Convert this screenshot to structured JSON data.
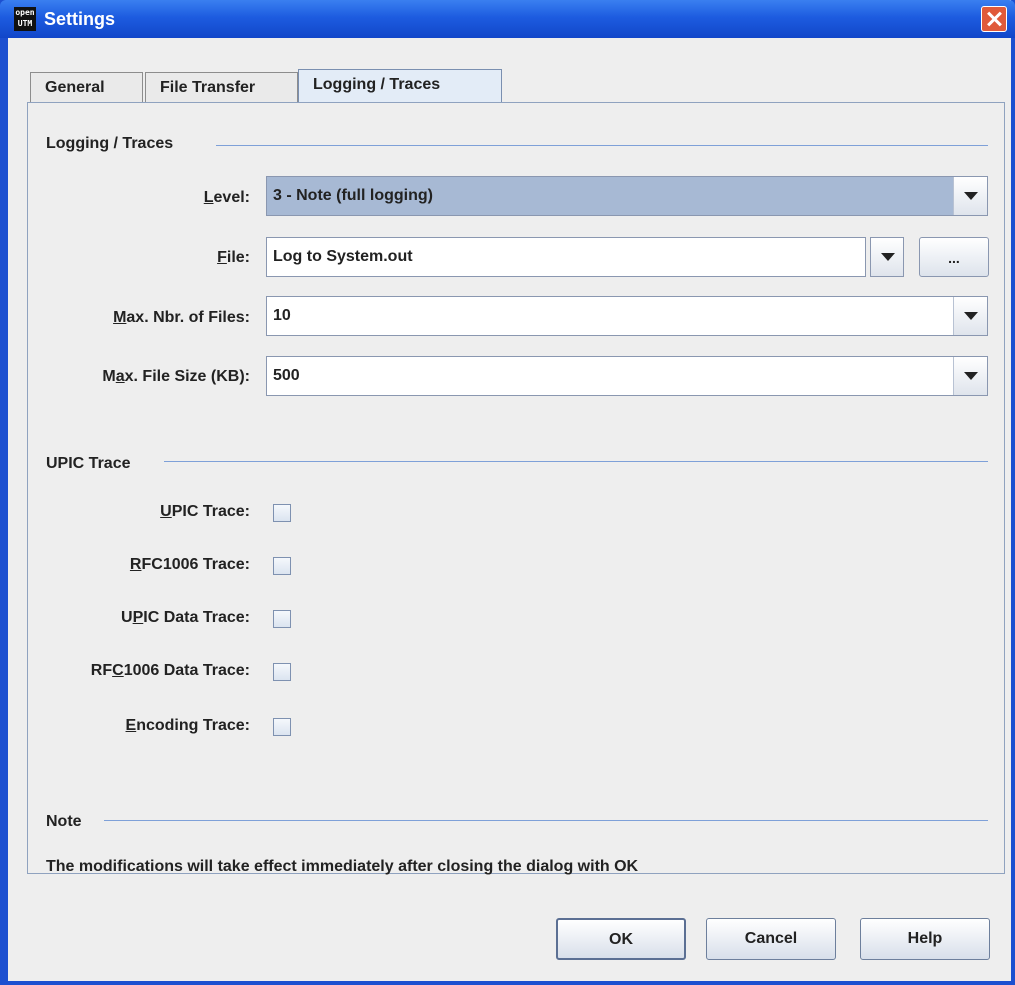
{
  "window": {
    "title": "Settings",
    "icon_text_top": "open",
    "icon_text_bottom": "UTM"
  },
  "tabs": [
    {
      "label": "General",
      "active": false
    },
    {
      "label": "File Transfer",
      "active": false
    },
    {
      "label": "Logging / Traces",
      "active": true
    }
  ],
  "logging": {
    "section_title": "Logging / Traces",
    "level": {
      "label_pre": "",
      "label_mn": "L",
      "label_post": "evel:",
      "value": "3 - Note (full logging)"
    },
    "file": {
      "label_pre": "",
      "label_mn": "F",
      "label_post": "ile:",
      "value": "Log to System.out",
      "browse_label": "..."
    },
    "max_files": {
      "label_pre": "",
      "label_mn": "M",
      "label_post": "ax. Nbr. of Files:",
      "value": "10"
    },
    "max_size": {
      "label_pre": "M",
      "label_mn": "a",
      "label_post": "x. File Size (KB):",
      "value": "500"
    }
  },
  "upic": {
    "section_title": "UPIC Trace",
    "items": [
      {
        "label_pre": "",
        "label_mn": "U",
        "label_post": "PIC Trace:",
        "checked": false
      },
      {
        "label_pre": "",
        "label_mn": "R",
        "label_post": "FC1006 Trace:",
        "checked": false
      },
      {
        "label_pre": "U",
        "label_mn": "P",
        "label_post": "IC Data Trace:",
        "checked": false
      },
      {
        "label_pre": "RF",
        "label_mn": "C",
        "label_post": "1006 Data Trace:",
        "checked": false
      },
      {
        "label_pre": "",
        "label_mn": "E",
        "label_post": "ncoding Trace:",
        "checked": false
      }
    ]
  },
  "note": {
    "section_title": "Note",
    "text": "The modifications will take effect immediately after closing the dialog with OK"
  },
  "buttons": {
    "ok": "OK",
    "cancel": "Cancel",
    "help": "Help"
  },
  "colors": {
    "titlebar": "#1d5ce0",
    "selected_combo": "#a7b9d4",
    "close": "#e05a3a"
  }
}
